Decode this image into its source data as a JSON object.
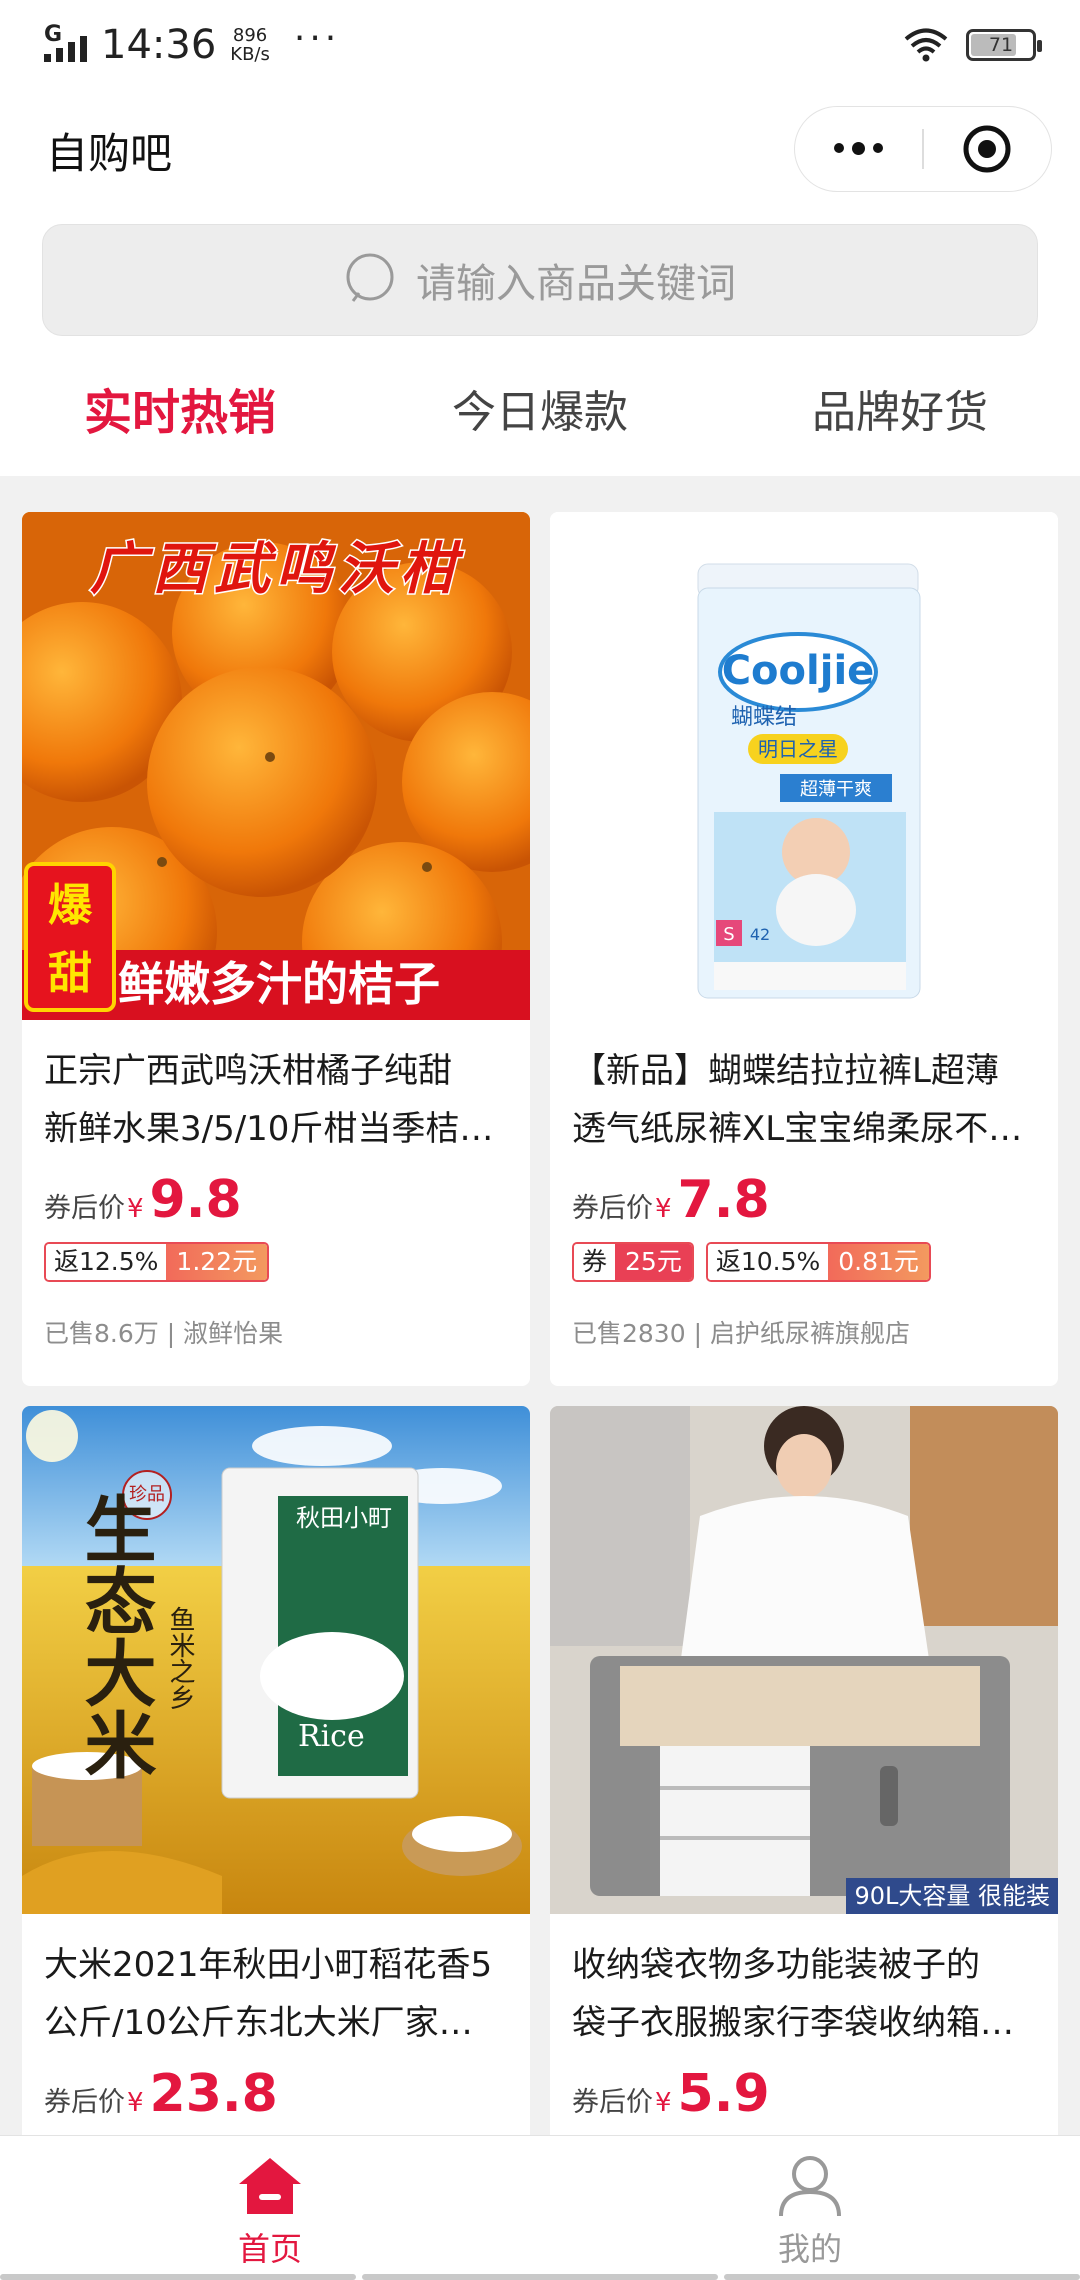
{
  "status_bar": {
    "network": "G",
    "time": "14:36",
    "speed_value": "896",
    "speed_unit": "KB/s",
    "more": "···",
    "battery": "71"
  },
  "nav": {
    "title": "自购吧"
  },
  "search": {
    "placeholder": "请输入商品关键词"
  },
  "tabs": [
    {
      "label": "实时热销",
      "active": true
    },
    {
      "label": "今日爆款",
      "active": false
    },
    {
      "label": "品牌好货",
      "active": false
    }
  ],
  "price_label": "券后价",
  "currency": "¥",
  "products": [
    {
      "image_banner": "广西武鸣沃柑",
      "image_badge": "爆甜",
      "image_caption": "鲜嫩多汁的桔子",
      "name_line1": "正宗广西武鸣沃柑橘子纯甜",
      "name_line2": "新鲜水果3/5/10斤柑当季桔…",
      "price": "9.8",
      "coupon": null,
      "rebate_label": "返12.5%",
      "rebate_value": "1.22元",
      "sold": "已售8.6万 | 淑鲜怡果"
    },
    {
      "image_brand": "Cooljie",
      "image_brand_cn": "蝴蝶结",
      "image_sub": "明日之星",
      "image_size": "S",
      "image_count": "42",
      "image_feature": "超薄干爽",
      "name_line1": "【新品】蝴蝶结拉拉裤L超薄",
      "name_line2": "透气纸尿裤XL宝宝绵柔尿不…",
      "price": "7.8",
      "coupon_label": "券",
      "coupon_value": "25元",
      "rebate_label": "返10.5%",
      "rebate_value": "0.81元",
      "sold": "已售2830 | 启护纸尿裤旗舰店"
    },
    {
      "image_tag": "珍品",
      "image_title": "生态大米",
      "image_sub": "鱼米之乡",
      "image_bag_cn": "秋田小町",
      "image_bag_en": "Rice",
      "name_line1": "大米2021年秋田小町稻花香5",
      "name_line2": "公斤/10公斤东北大米厂家…",
      "price": "23.8"
    },
    {
      "image_caption": "90L大容量 很能装",
      "name_line1": "收纳袋衣物多功能装被子的",
      "name_line2": "袋子衣服搬家行李袋收纳箱…",
      "price": "5.9"
    }
  ],
  "tabbar": [
    {
      "label": "首页",
      "icon": "home-icon",
      "active": true
    },
    {
      "label": "我的",
      "icon": "user-icon",
      "active": false
    }
  ],
  "colors": {
    "accent": "#e3173f",
    "rebate_gradient_start": "#f26a5a",
    "rebate_gradient_end": "#f39a5f"
  }
}
